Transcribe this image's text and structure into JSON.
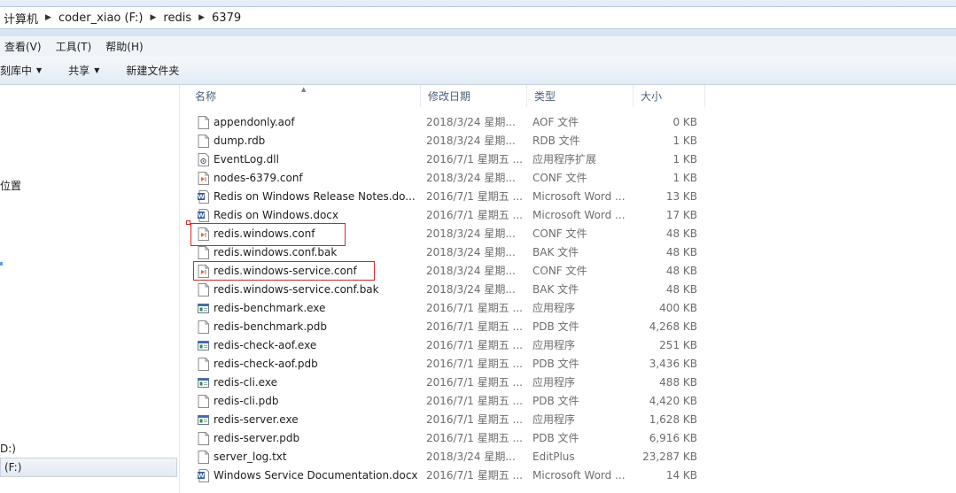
{
  "address": {
    "crumbs": [
      "计算机",
      "coder_xiao (F:)",
      "redis",
      "6379"
    ]
  },
  "menu": [
    "查看(V)",
    "工具(T)",
    "帮助(H)"
  ],
  "toolbar": {
    "organize": "刻库中",
    "share": "共享",
    "new_folder": "新建文件夹"
  },
  "nav": {
    "location": "位置",
    "drive_partial": "D:)",
    "selected": "(F:)"
  },
  "columns": {
    "name": "名称",
    "modified": "修改日期",
    "type": "类型",
    "size": "大小"
  },
  "files": [
    {
      "name": "appendonly.aof",
      "date": "2018/3/24 星期...",
      "type": "AOF 文件",
      "size": "0 KB",
      "icon": "blank-file-icon"
    },
    {
      "name": "dump.rdb",
      "date": "2018/3/24 星期...",
      "type": "RDB 文件",
      "size": "1 KB",
      "icon": "blank-file-icon"
    },
    {
      "name": "EventLog.dll",
      "date": "2016/7/1 星期五 ...",
      "type": "应用程序扩展",
      "size": "1 KB",
      "icon": "dll-file-icon"
    },
    {
      "name": "nodes-6379.conf",
      "date": "2018/3/24 星期...",
      "type": "CONF 文件",
      "size": "1 KB",
      "icon": "conf-file-icon"
    },
    {
      "name": "Redis on Windows Release Notes.do...",
      "date": "2016/7/1 星期五 ...",
      "type": "Microsoft Word ...",
      "size": "13 KB",
      "icon": "word-doc-icon"
    },
    {
      "name": "Redis on Windows.docx",
      "date": "2016/7/1 星期五 ...",
      "type": "Microsoft Word ...",
      "size": "17 KB",
      "icon": "word-doc-icon"
    },
    {
      "name": "redis.windows.conf",
      "date": "2018/3/24 星期...",
      "type": "CONF 文件",
      "size": "48 KB",
      "icon": "conf-file-icon"
    },
    {
      "name": "redis.windows.conf.bak",
      "date": "2018/3/24 星期...",
      "type": "BAK 文件",
      "size": "48 KB",
      "icon": "blank-file-icon"
    },
    {
      "name": "redis.windows-service.conf",
      "date": "2018/3/24 星期...",
      "type": "CONF 文件",
      "size": "48 KB",
      "icon": "conf-file-icon"
    },
    {
      "name": "redis.windows-service.conf.bak",
      "date": "2018/3/24 星期...",
      "type": "BAK 文件",
      "size": "48 KB",
      "icon": "blank-file-icon"
    },
    {
      "name": "redis-benchmark.exe",
      "date": "2016/7/1 星期五 ...",
      "type": "应用程序",
      "size": "400 KB",
      "icon": "exe-file-icon"
    },
    {
      "name": "redis-benchmark.pdb",
      "date": "2016/7/1 星期五 ...",
      "type": "PDB 文件",
      "size": "4,268 KB",
      "icon": "blank-file-icon"
    },
    {
      "name": "redis-check-aof.exe",
      "date": "2016/7/1 星期五 ...",
      "type": "应用程序",
      "size": "251 KB",
      "icon": "exe-file-icon"
    },
    {
      "name": "redis-check-aof.pdb",
      "date": "2016/7/1 星期五 ...",
      "type": "PDB 文件",
      "size": "3,436 KB",
      "icon": "blank-file-icon"
    },
    {
      "name": "redis-cli.exe",
      "date": "2016/7/1 星期五 ...",
      "type": "应用程序",
      "size": "488 KB",
      "icon": "exe-file-icon"
    },
    {
      "name": "redis-cli.pdb",
      "date": "2016/7/1 星期五 ...",
      "type": "PDB 文件",
      "size": "4,420 KB",
      "icon": "blank-file-icon"
    },
    {
      "name": "redis-server.exe",
      "date": "2016/7/1 星期五 ...",
      "type": "应用程序",
      "size": "1,628 KB",
      "icon": "exe-file-icon"
    },
    {
      "name": "redis-server.pdb",
      "date": "2016/7/1 星期五 ...",
      "type": "PDB 文件",
      "size": "6,916 KB",
      "icon": "blank-file-icon"
    },
    {
      "name": "server_log.txt",
      "date": "2018/3/24 星期...",
      "type": "EditPlus",
      "size": "23,287 KB",
      "icon": "text-file-icon"
    },
    {
      "name": "Windows Service Documentation.docx",
      "date": "2016/7/1 星期五 ...",
      "type": "Microsoft Word ...",
      "size": "14 KB",
      "icon": "word-doc-icon"
    }
  ],
  "colors": {
    "highlight": "#d02828",
    "word_blue": "#2b5797",
    "conf_orange": "#e06a2a"
  }
}
